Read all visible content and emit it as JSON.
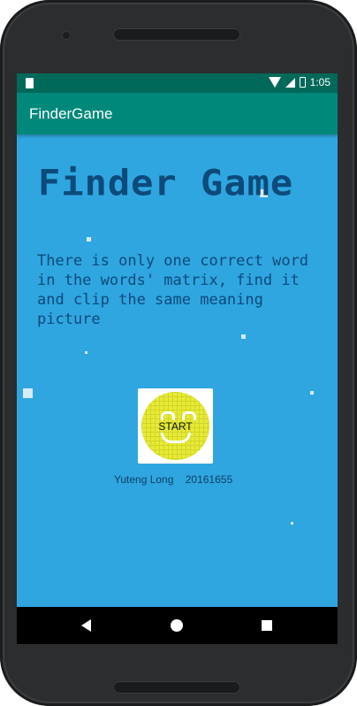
{
  "statusbar": {
    "time": "1:05",
    "icons": [
      "sim-icon",
      "wifi-icon",
      "signal-icon",
      "battery-icon"
    ]
  },
  "appbar": {
    "title": "FinderGame"
  },
  "main": {
    "game_title": "Finder Game",
    "instructions": "There is only one correct word in the words' matrix, find it and clip the same meaning picture",
    "start_button": {
      "label": "START",
      "icon": "smiley-face-icon"
    },
    "credit": "Yuteng Long    20161655"
  },
  "navbar": {
    "icons": [
      "back-icon",
      "home-icon",
      "recents-icon"
    ]
  },
  "colors": {
    "statusbar": "#00695a",
    "appbar": "#00897a",
    "background": "#2fa6e0",
    "title_text": "#0d4a7a",
    "button_yellow": "#e8ea34"
  }
}
